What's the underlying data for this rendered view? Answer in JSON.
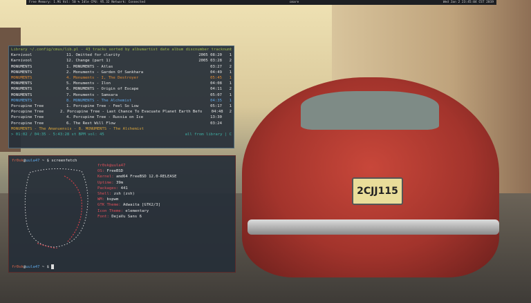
{
  "topbar": {
    "left": "Free Memory: 1.9G  Vol: 50 %  Idle CPU: 95.32  Network: Connected",
    "center": "cmare",
    "right": "Wed Jan  2 23:45:04 CST 2019"
  },
  "music": {
    "header": "Library ~/.config/cmus/lib.pl - 43 tracks sorted by albumartist date album discnumber tracknumber",
    "rows": [
      {
        "artist": "Karnivool",
        "title": "11. Omitted for clarity",
        "time": "2005 08:20",
        "n": "1"
      },
      {
        "artist": "Karnivool",
        "title": "12. Change (part 1)",
        "time": "2005 03:28",
        "n": "2"
      },
      {
        "artist": "MONUMENTS",
        "title": "1. MONUMENTS - Atlas",
        "time": "03:27",
        "n": "2"
      },
      {
        "artist": "MONUMENTS",
        "title": "2. Monuments - Garden Of Sankhara",
        "time": "04:49",
        "n": "1"
      },
      {
        "artist": "MONUMENTS",
        "title": "4. Monuments - I, The Destroyer",
        "time": "05:45",
        "n": "1"
      },
      {
        "artist": "MONUMENTS",
        "title": "5. Monuments - Ilon",
        "time": "04:08",
        "n": "1"
      },
      {
        "artist": "MONUMENTS",
        "title": "6. MONUMENTS - Origin of Escape",
        "time": "04:11",
        "n": "2"
      },
      {
        "artist": "MONUMENTS",
        "title": "7. Monuments - Samsara",
        "time": "05:07",
        "n": "1"
      },
      {
        "artist": "MONUMENTS",
        "title": "8. MONUMENTS - The Alchemist",
        "time": "04:35",
        "n": "1"
      },
      {
        "artist": "Porcupine Tree",
        "title": "1. Porcupine Tree - Feel So Low",
        "time": "05:17",
        "n": "1"
      },
      {
        "artist": "Porcupine Tree",
        "title": "2. Porcupine Tree - Last Chance To Evacuate Planet Earth Befo",
        "time": "04:48",
        "n": "2"
      },
      {
        "artist": "Porcupine Tree",
        "title": "4. Porcupine Tree - Russia on Ice",
        "time": "13:30",
        "n": ""
      },
      {
        "artist": "Porcupine Tree",
        "title": "6. The Rest Will Flow",
        "time": "03:24",
        "n": ""
      }
    ],
    "now_playing": "MONUMENTS - The Amanuensis - 8. MONUMENTS - The Alchemist",
    "status_left": "> 01:02 / 04:35 - 5:43:28 st  BPM vol: 45",
    "status_right": "all from library | C"
  },
  "fetch": {
    "user": "fr0sk",
    "host": "uula47",
    "sep": "@",
    "cmd": " ~ $ screenfetch",
    "title": "fr0sk@uula47",
    "info": [
      {
        "k": "OS:",
        "v": " FreeBSD"
      },
      {
        "k": "Kernel:",
        "v": " amd64 FreeBSD 12.0-RELEASE"
      },
      {
        "k": "Uptime:",
        "v": " 39m"
      },
      {
        "k": "Packages:",
        "v": " 441"
      },
      {
        "k": "Shell:",
        "v": " zsh (zsh)"
      },
      {
        "k": "WM:",
        "v": " bspwm"
      },
      {
        "k": "GTK Theme:",
        "v": " Adwaita [GTK2/3]"
      },
      {
        "k": "Icon Theme:",
        "v": " elementary"
      },
      {
        "k": "Font:",
        "v": " DejaVu Sans 6"
      }
    ],
    "prompt_end": " ~ $ "
  },
  "plate": "2CJJ115"
}
